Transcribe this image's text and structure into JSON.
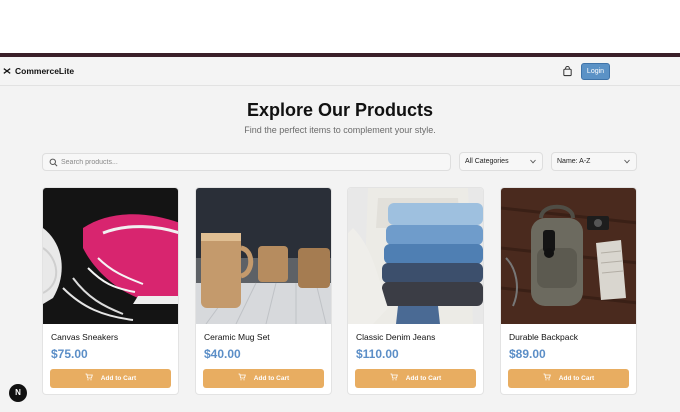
{
  "header": {
    "brand": "CommerceLite",
    "login_label": "Login"
  },
  "hero": {
    "title": "Explore Our Products",
    "subtitle": "Find the perfect items to complement your style."
  },
  "filters": {
    "search_placeholder": "Search products...",
    "category_selected": "All Categories",
    "sort_selected": "Name: A-Z"
  },
  "products": [
    {
      "name": "Canvas Sneakers",
      "price": "$75.00",
      "cta": "Add to Cart"
    },
    {
      "name": "Ceramic Mug Set",
      "price": "$40.00",
      "cta": "Add to Cart"
    },
    {
      "name": "Classic Denim Jeans",
      "price": "$110.00",
      "cta": "Add to Cart"
    },
    {
      "name": "Durable Backpack",
      "price": "$89.00",
      "cta": "Add to Cart"
    }
  ],
  "dev_badge": "N",
  "colors": {
    "accent_blue": "#5b92c6",
    "price_blue": "#5b8ec7",
    "cart_button": "#e8ad61",
    "frame_bar": "#3a1f29"
  },
  "icons": [
    "brand-logo-icon",
    "cart-icon",
    "search-icon",
    "chevron-down-icon",
    "cart-mini-icon"
  ]
}
